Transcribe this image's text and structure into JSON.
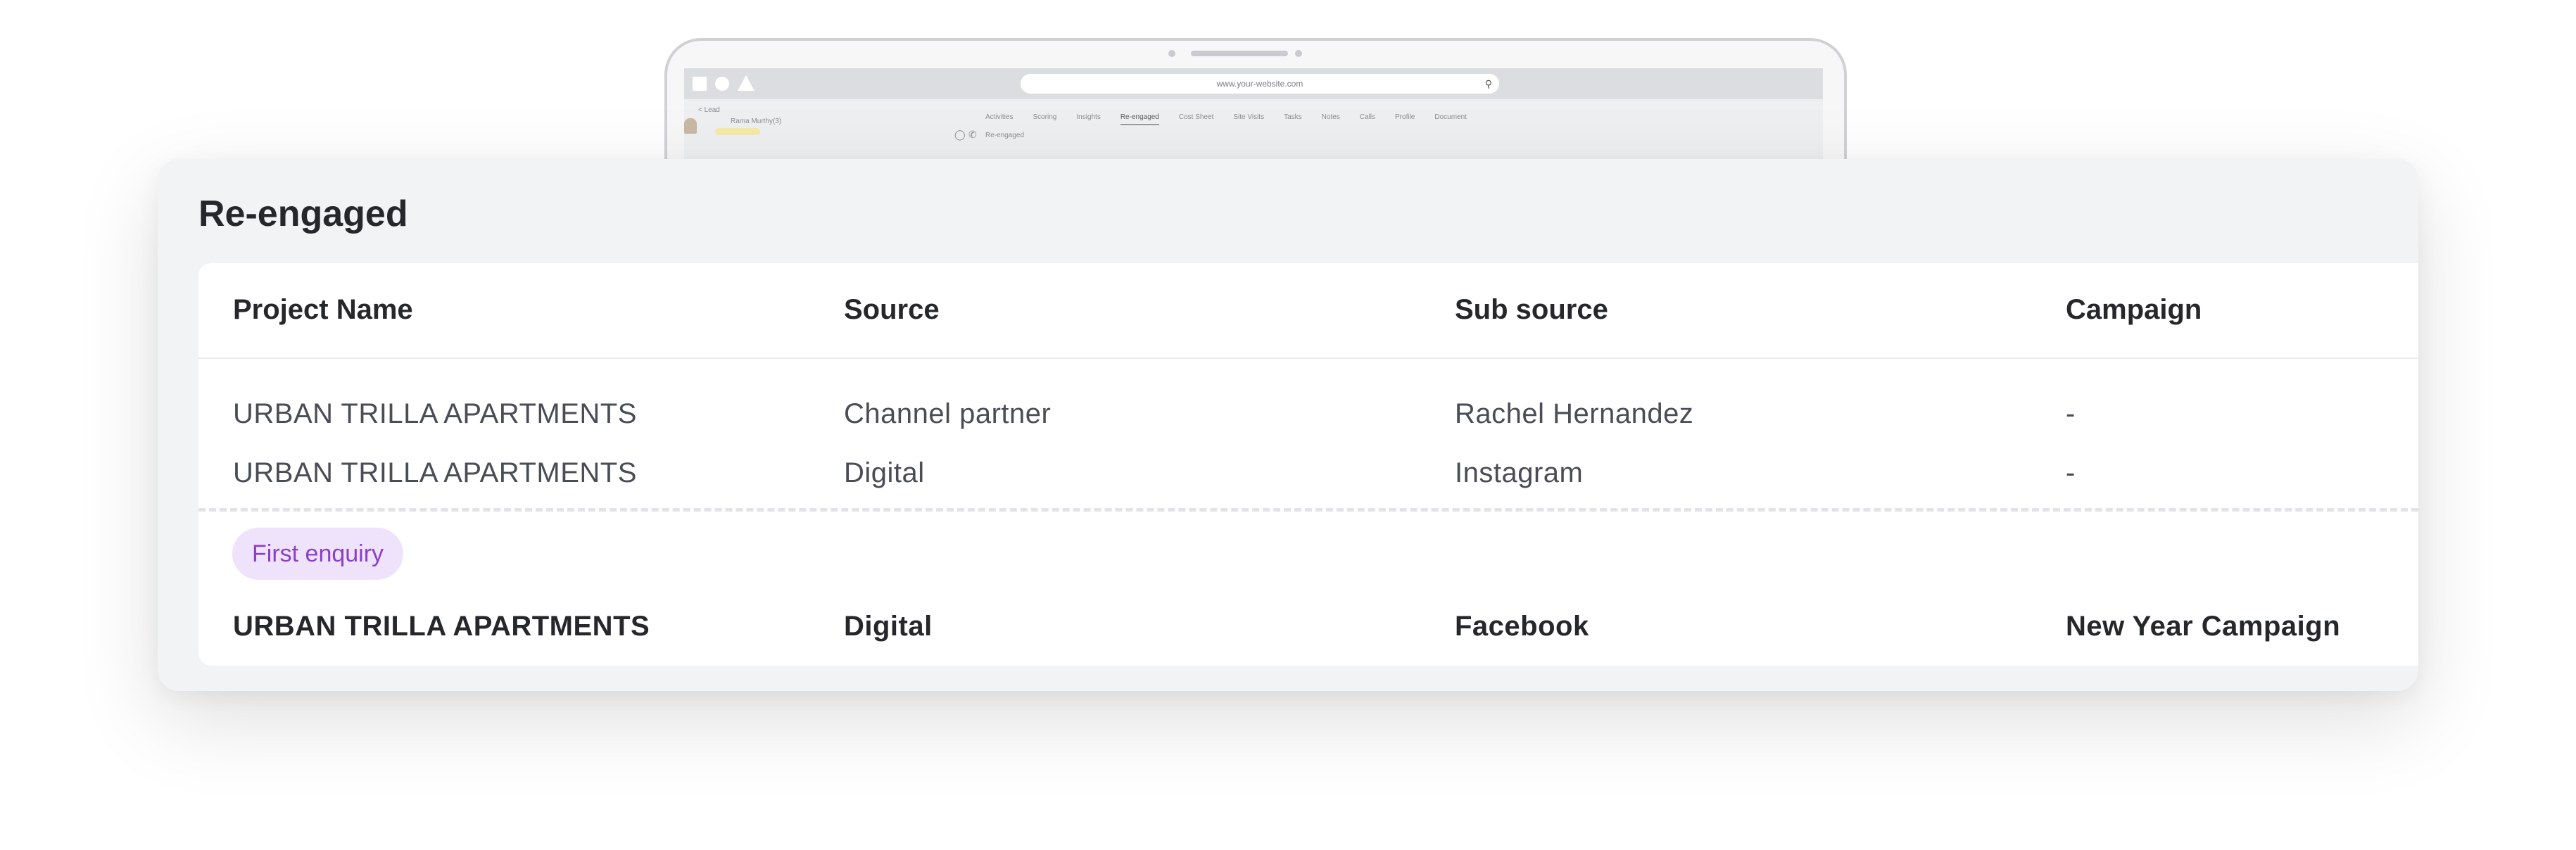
{
  "browser": {
    "url": "www.your-website.com"
  },
  "mini_app": {
    "breadcrumb": "< Lead",
    "lead_name": "Rama Murthy(3)",
    "tabs": [
      "Activities",
      "Scoring",
      "Insights",
      "Re-engaged",
      "Cost Sheet",
      "Site Visits",
      "Tasks",
      "Notes",
      "Calls",
      "Profile",
      "Document"
    ],
    "active_tab": "Re-engaged",
    "section_label": "Re-engaged"
  },
  "card": {
    "title": "Re-engaged",
    "columns": [
      "Project Name",
      "Source",
      "Sub source",
      "Campaign"
    ],
    "rows": [
      {
        "project": "URBAN TRILLA APARTMENTS",
        "source": "Channel partner",
        "sub_source": "Rachel Hernandez",
        "campaign": "-"
      },
      {
        "project": "URBAN TRILLA APARTMENTS",
        "source": "Digital",
        "sub_source": "Instagram",
        "campaign": "-"
      }
    ],
    "first_enquiry": {
      "badge": "First enquiry",
      "project": "URBAN TRILLA APARTMENTS",
      "source": "Digital",
      "sub_source": "Facebook",
      "campaign": "New Year Campaign"
    }
  },
  "colors": {
    "card_bg": "#f2f3f5",
    "table_bg": "#ffffff",
    "badge_bg": "#efe3fb",
    "badge_text": "#8a3fc9",
    "text_primary": "#25272b",
    "text_secondary": "#4a4d55"
  }
}
